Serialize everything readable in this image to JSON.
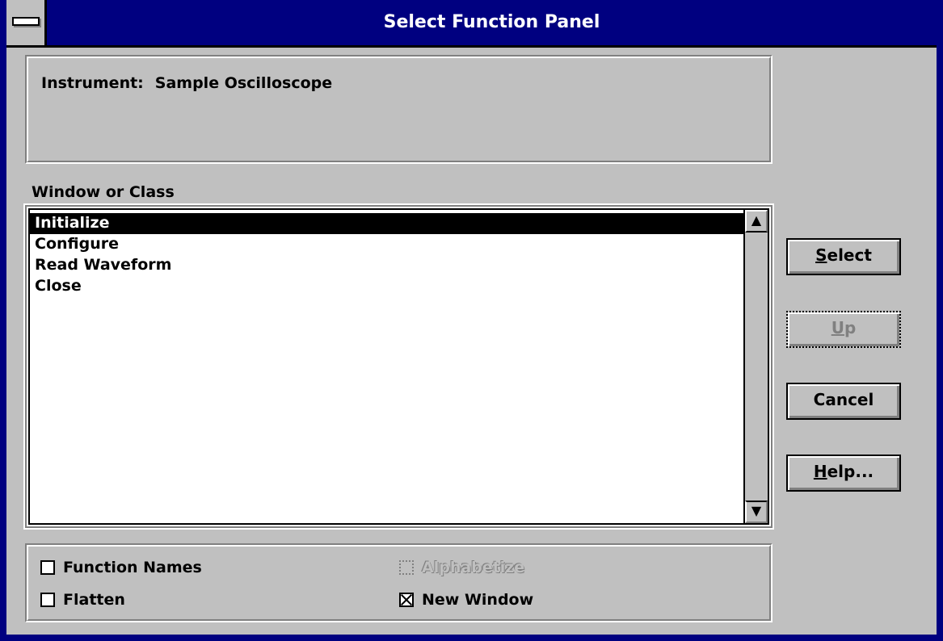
{
  "window": {
    "title": "Select Function Panel"
  },
  "instrument": {
    "label": "Instrument:",
    "value": "Sample Oscilloscope"
  },
  "list": {
    "label": "Window or Class",
    "items": [
      "Initialize",
      "Configure",
      "Read Waveform",
      "Close"
    ],
    "selected_index": 0
  },
  "options": {
    "function_names": {
      "label": "Function Names",
      "checked": false,
      "enabled": true
    },
    "flatten": {
      "label": "Flatten",
      "checked": false,
      "enabled": true
    },
    "alphabetize": {
      "label": "Alphabetize",
      "checked": false,
      "enabled": false
    },
    "new_window": {
      "label": "New Window",
      "checked": true,
      "enabled": true
    }
  },
  "buttons": {
    "select": {
      "mnemonic": "S",
      "rest": "elect",
      "enabled": true
    },
    "up": {
      "mnemonic": "U",
      "rest": "p",
      "enabled": false
    },
    "cancel": {
      "label": "Cancel",
      "enabled": true
    },
    "help": {
      "mnemonic": "H",
      "rest": "elp...",
      "enabled": true
    }
  },
  "icons": {
    "scroll_up": "▲",
    "scroll_down": "▼"
  },
  "colors": {
    "title_bar": "#000080",
    "face": "#c0c0c0",
    "selection": "#000000"
  }
}
